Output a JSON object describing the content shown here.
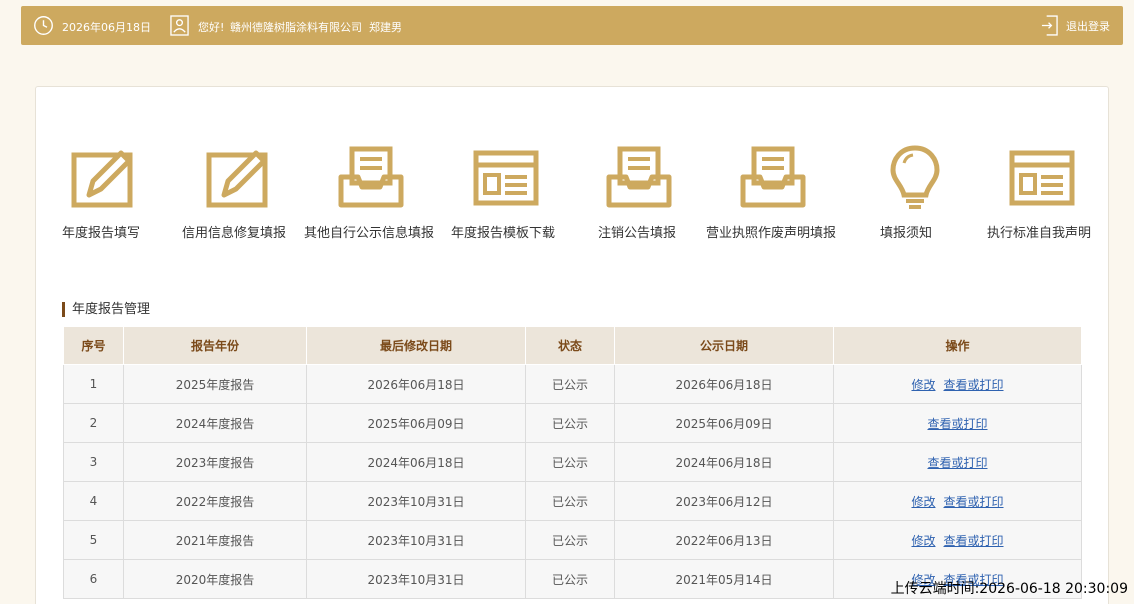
{
  "topbar": {
    "date": "2026年06月18日",
    "greeting": "您好!",
    "company": "赣州德隆树脂涂料有限公司",
    "person": "郑建男",
    "logout": "退出登录"
  },
  "functions": [
    {
      "label": "年度报告填写",
      "icon": "edit-icon"
    },
    {
      "label": "信用信息修复填报",
      "icon": "edit-icon"
    },
    {
      "label": "其他自行公示信息填报",
      "icon": "inbox-tray-icon"
    },
    {
      "label": "年度报告模板下载",
      "icon": "template-icon"
    },
    {
      "label": "注销公告填报",
      "icon": "inbox-tray-icon"
    },
    {
      "label": "营业执照作废声明填报",
      "icon": "inbox-tray-icon"
    },
    {
      "label": "填报须知",
      "icon": "lightbulb-icon"
    },
    {
      "label": "执行标准自我声明",
      "icon": "template-icon"
    }
  ],
  "section": {
    "title": "年度报告管理"
  },
  "table": {
    "headers": [
      "序号",
      "报告年份",
      "最后修改日期",
      "状态",
      "公示日期",
      "操作"
    ],
    "rows": [
      {
        "no": "1",
        "year": "2025年度报告",
        "modified": "2026年06月18日",
        "status": "已公示",
        "published": "2026年06月18日",
        "edit": "修改",
        "view": "查看或打印"
      },
      {
        "no": "2",
        "year": "2024年度报告",
        "modified": "2025年06月09日",
        "status": "已公示",
        "published": "2025年06月09日",
        "edit": "",
        "view": "查看或打印"
      },
      {
        "no": "3",
        "year": "2023年度报告",
        "modified": "2024年06月18日",
        "status": "已公示",
        "published": "2024年06月18日",
        "edit": "",
        "view": "查看或打印"
      },
      {
        "no": "4",
        "year": "2022年度报告",
        "modified": "2023年10月31日",
        "status": "已公示",
        "published": "2023年06月12日",
        "edit": "修改",
        "view": "查看或打印"
      },
      {
        "no": "5",
        "year": "2021年度报告",
        "modified": "2023年10月31日",
        "status": "已公示",
        "published": "2022年06月13日",
        "edit": "修改",
        "view": "查看或打印"
      },
      {
        "no": "6",
        "year": "2020年度报告",
        "modified": "2023年10月31日",
        "status": "已公示",
        "published": "2021年05月14日",
        "edit": "修改",
        "view": "查看或打印"
      }
    ]
  },
  "upload_stamp": "上传云端时间:2026-06-18 20:30:09",
  "colors": {
    "gold": "#cda95f",
    "brown": "#7b4a1a",
    "link": "#2f62b0"
  }
}
